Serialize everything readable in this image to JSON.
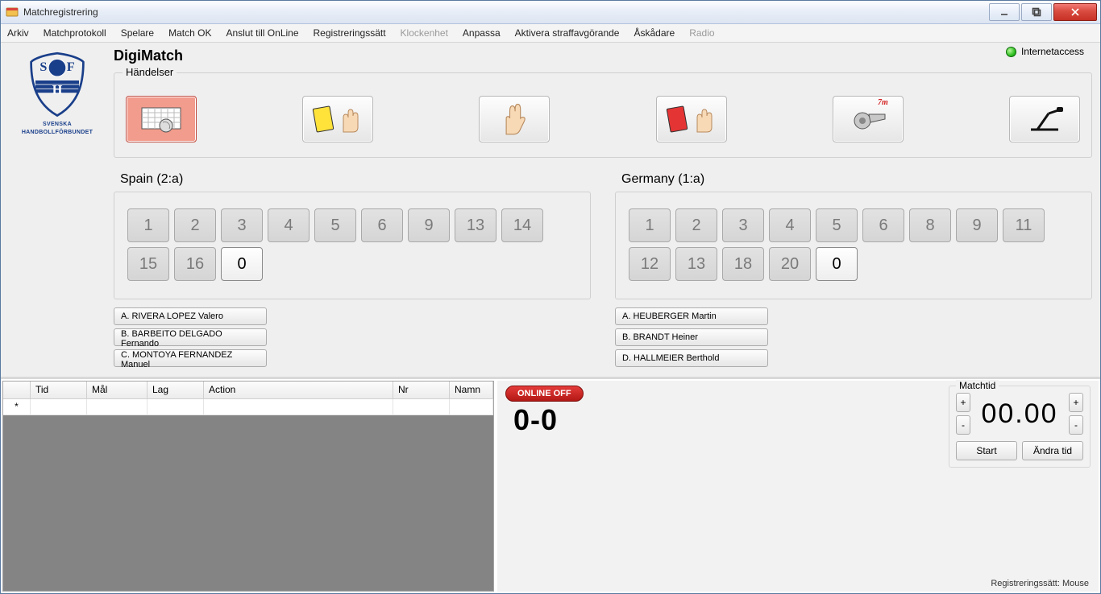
{
  "window": {
    "title": "Matchregistrering"
  },
  "menu": {
    "items": [
      {
        "label": "Arkiv",
        "disabled": false
      },
      {
        "label": "Matchprotokoll",
        "disabled": false
      },
      {
        "label": "Spelare",
        "disabled": false
      },
      {
        "label": "Match OK",
        "disabled": false
      },
      {
        "label": "Anslut till OnLine",
        "disabled": false
      },
      {
        "label": "Registreringssätt",
        "disabled": false
      },
      {
        "label": "Klockenhet",
        "disabled": true
      },
      {
        "label": "Anpassa",
        "disabled": false
      },
      {
        "label": "Aktivera straffavgörande",
        "disabled": false
      },
      {
        "label": "Åskådare",
        "disabled": false
      },
      {
        "label": "Radio",
        "disabled": true
      }
    ]
  },
  "app_title": "DigiMatch",
  "logo": {
    "line1": "SVENSKA",
    "line2": "HANDBOLLFÖRBUNDET"
  },
  "status": {
    "internet_label": "Internetaccess"
  },
  "events_group_label": "Händelser",
  "events": {
    "goal": "goal-icon",
    "yellow_card": "yellow-card-icon",
    "two_min": "two-min-icon",
    "red_card": "red-card-icon",
    "seven_m": "seven-m-icon",
    "seven_m_text": "7m",
    "other": "mic-icon"
  },
  "teams": {
    "home": {
      "name": "Spain (2:a)",
      "numbers": [
        "1",
        "2",
        "3",
        "4",
        "5",
        "6",
        "9",
        "13",
        "14",
        "15",
        "16",
        "0"
      ],
      "active_index": 11,
      "officials": [
        "A. RIVERA LOPEZ Valero",
        "B. BARBEITO DELGADO Fernando",
        "C. MONTOYA FERNANDEZ Manuel"
      ]
    },
    "away": {
      "name": "Germany (1:a)",
      "numbers": [
        "1",
        "2",
        "3",
        "4",
        "5",
        "6",
        "8",
        "9",
        "11",
        "12",
        "13",
        "18",
        "20",
        "0"
      ],
      "active_index": 13,
      "officials": [
        "A. HEUBERGER Martin",
        "B. BRANDT Heiner",
        "D. HALLMEIER Berthold"
      ]
    }
  },
  "log": {
    "columns": {
      "star": "*",
      "tid": "Tid",
      "mal": "Mål",
      "lag": "Lag",
      "action": "Action",
      "nr": "Nr",
      "namn": "Namn"
    }
  },
  "score_panel": {
    "online_label": "ONLINE OFF",
    "score": "0-0"
  },
  "clock_panel": {
    "label": "Matchtid",
    "time": "00.00",
    "start": "Start",
    "change": "Ändra tid",
    "plus": "+",
    "minus": "-"
  },
  "footer": {
    "regmode": "Registreringssätt: Mouse"
  }
}
